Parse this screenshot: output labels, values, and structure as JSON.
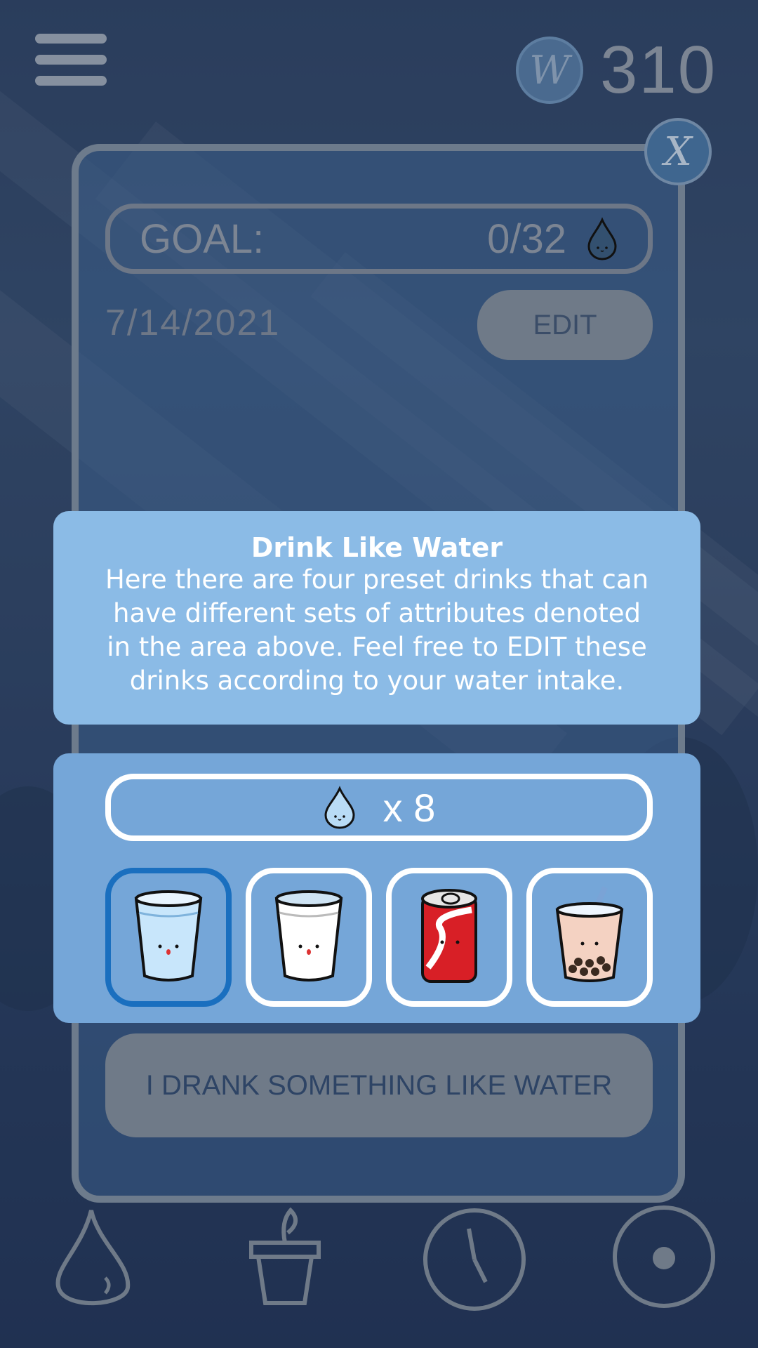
{
  "topbar": {
    "coins": "310",
    "coin_symbol": "W",
    "close_symbol": "X"
  },
  "goal": {
    "label": "GOAL:",
    "progress": "0/32"
  },
  "date": "7/14/2021",
  "edit_label": "EDIT",
  "tooltip": {
    "title": "Drink Like Water",
    "body": "Here there are four preset drinks that can have different sets of attributes denoted in the area above. Feel free to EDIT these drinks according to your water intake."
  },
  "drop_count": "x 8",
  "drinks": [
    {
      "icon": "water-glass-icon",
      "selected": true
    },
    {
      "icon": "milk-glass-icon",
      "selected": false
    },
    {
      "icon": "soda-can-icon",
      "selected": false
    },
    {
      "icon": "bubble-tea-icon",
      "selected": false
    }
  ],
  "drank_button": "I DRANK SOMETHING LIKE WATER",
  "nav": [
    "water-drop-icon",
    "plant-pot-icon",
    "clock-icon",
    "record-icon"
  ],
  "colors": {
    "tooltip": "#8bbbe6",
    "panel": "#75a6d8",
    "selected": "#1a6fbf"
  }
}
